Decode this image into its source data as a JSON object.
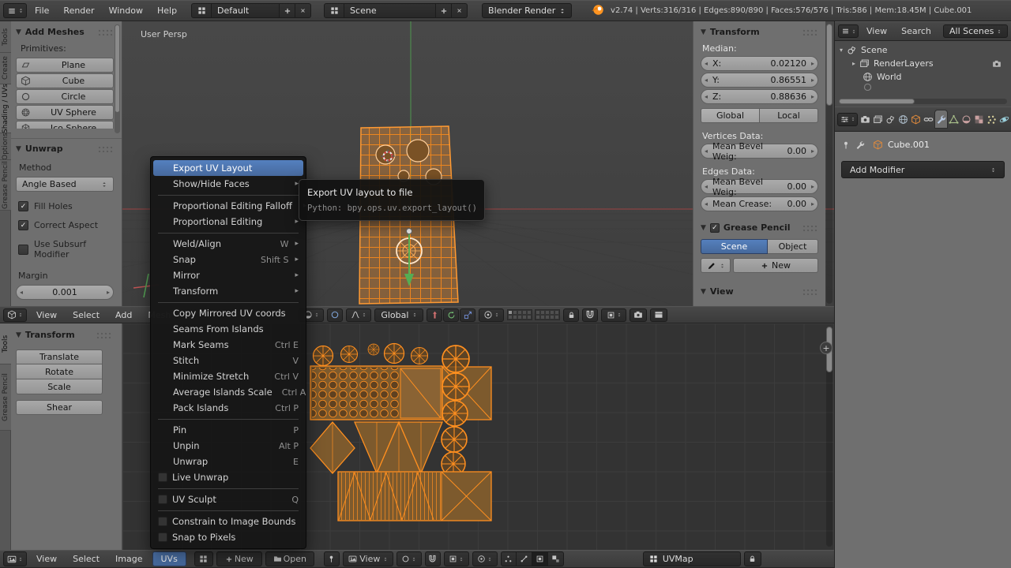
{
  "topbar": {
    "menus": [
      "File",
      "Render",
      "Window",
      "Help"
    ],
    "layout_value": "Default",
    "scene_value": "Scene",
    "engine_value": "Blender Render",
    "stats": "v2.74 | Verts:316/316 | Edges:890/890 | Faces:576/576 | Tris:586 | Mem:18.45M | Cube.001"
  },
  "toolshelf3d": {
    "tabs": [
      "Tools",
      "Create",
      "Shading / UVs",
      "Options",
      "Grease Pencil"
    ],
    "add_meshes": {
      "title": "Add Meshes",
      "primitives_label": "Primitives:",
      "buttons": [
        "Plane",
        "Cube",
        "Circle",
        "UV Sphere",
        "Ico Sphere"
      ]
    },
    "unwrap": {
      "title": "Unwrap",
      "method_label": "Method",
      "method_value": "Angle Based",
      "fill_holes": "Fill Holes",
      "correct_aspect": "Correct Aspect",
      "use_subsurf": "Use Subsurf Modifier",
      "margin_label": "Margin",
      "margin_value": "0.001"
    }
  },
  "viewport": {
    "view_label": "User Persp",
    "object_label": "Cube.001"
  },
  "view3d_header": {
    "menus": [
      "View",
      "Select",
      "Add",
      "Mesh"
    ],
    "orientation": "Global"
  },
  "uvs_menu": {
    "items": [
      {
        "label": "Export UV Layout"
      },
      {
        "label": "Show/Hide Faces"
      },
      {
        "label": "Proportional Editing Falloff"
      },
      {
        "label": "Proportional Editing"
      },
      {
        "label": "Weld/Align",
        "shortcut": "W"
      },
      {
        "label": "Snap",
        "shortcut": "Shift S"
      },
      {
        "label": "Mirror"
      },
      {
        "label": "Transform"
      },
      {
        "label": "Copy Mirrored UV coords"
      },
      {
        "label": "Seams From Islands"
      },
      {
        "label": "Mark Seams",
        "shortcut": "Ctrl E"
      },
      {
        "label": "Stitch",
        "shortcut": "V"
      },
      {
        "label": "Minimize Stretch",
        "shortcut": "Ctrl V"
      },
      {
        "label": "Average Islands Scale",
        "shortcut": "Ctrl A"
      },
      {
        "label": "Pack Islands",
        "shortcut": "Ctrl P"
      },
      {
        "label": "Pin",
        "shortcut": "P"
      },
      {
        "label": "Unpin",
        "shortcut": "Alt P"
      },
      {
        "label": "Unwrap",
        "shortcut": "E"
      },
      {
        "label": "Live Unwrap"
      },
      {
        "label": "UV Sculpt",
        "shortcut": "Q"
      },
      {
        "label": "Constrain to Image Bounds"
      },
      {
        "label": "Snap to Pixels"
      }
    ]
  },
  "tooltip": {
    "title": "Export UV layout to file",
    "python": "Python: bpy.ops.uv.export_layout()"
  },
  "n_panel": {
    "transform_title": "Transform",
    "median_label": "Median:",
    "x_label": "X:",
    "x_value": "0.02120",
    "y_label": "Y:",
    "y_value": "0.86551",
    "z_label": "Z:",
    "z_value": "0.88636",
    "global_label": "Global",
    "local_label": "Local",
    "vertices_data_label": "Vertices Data:",
    "mean_bevel_label": "Mean Bevel Weig:",
    "mean_bevel_value": "0.00",
    "edges_data_label": "Edges Data:",
    "mean_bevel2_label": "Mean Bevel Weig:",
    "mean_bevel2_value": "0.00",
    "mean_crease_label": "Mean Crease:",
    "mean_crease_value": "0.00",
    "grease_title": "Grease Pencil",
    "gp_scene": "Scene",
    "gp_object": "Object",
    "gp_new": "New",
    "view_title": "View"
  },
  "outliner": {
    "view_menu": "View",
    "search_menu": "Search",
    "display_mode": "All Scenes",
    "items": [
      "Scene",
      "RenderLayers",
      "World"
    ]
  },
  "properties": {
    "breadcrumb": "Cube.001",
    "add_modifier_label": "Add Modifier"
  },
  "uv_toolshelf": {
    "tabs": [
      "Tools",
      "Grease Pencil"
    ],
    "transform_title": "Transform",
    "buttons": [
      "Translate",
      "Rotate",
      "Scale",
      "Shear"
    ]
  },
  "uv_header": {
    "menus": [
      "View",
      "Select",
      "Image"
    ],
    "uvs_label": "UVs",
    "new_label": "New",
    "open_label": "Open",
    "view_dropdown_label": "View",
    "uvmap_value": "UVMap"
  }
}
